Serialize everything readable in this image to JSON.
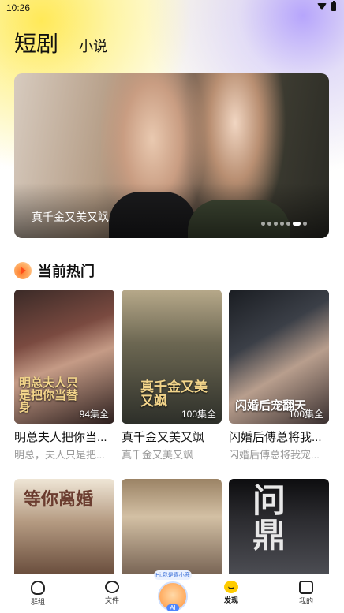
{
  "status_bar": {
    "time": "10:26",
    "icons": [
      "wifi-icon",
      "battery-icon"
    ]
  },
  "top_tabs": {
    "active": "短剧",
    "other": "小说"
  },
  "banner": {
    "title": "真千金又美又飒",
    "dot_count": 7,
    "active_dot": 6
  },
  "section": {
    "title": "当前热门",
    "icon": "fire-icon"
  },
  "cards": [
    {
      "title": "明总夫人把你当...",
      "desc": "明总，夫人只是把...",
      "badge": "94集全",
      "cover_art": "明总夫人只是把你当替身"
    },
    {
      "title": "真千金又美又飒",
      "desc": "真千金又美又飒",
      "badge": "100集全",
      "cover_art": "真千金又美又飒"
    },
    {
      "title": "闪婚后傅总将我...",
      "desc": "闪婚后傅总将我宠...",
      "badge": "100集全",
      "cover_art": "闪婚后宠翻天"
    },
    {
      "title": "",
      "desc": "",
      "badge": "",
      "cover_art": "等你离婚"
    },
    {
      "title": "",
      "desc": "",
      "badge": "",
      "cover_art": ""
    },
    {
      "title": "",
      "desc": "",
      "badge": "",
      "cover_art": "问鼎"
    }
  ],
  "bottom_nav": {
    "items": [
      {
        "label": "群组",
        "icon": "group-icon"
      },
      {
        "label": "文件",
        "icon": "file-icon"
      },
      {
        "label": "发现",
        "icon": "discover-icon",
        "active": true
      },
      {
        "label": "我的",
        "icon": "me-icon"
      }
    ],
    "ai": {
      "hint": "Hi,我是喜小鹿",
      "label": "AI"
    }
  },
  "colors": {
    "accent": "#ffcc00",
    "fire": "#ff6a1a",
    "text": "#111111",
    "muted": "#9a9a9a"
  }
}
